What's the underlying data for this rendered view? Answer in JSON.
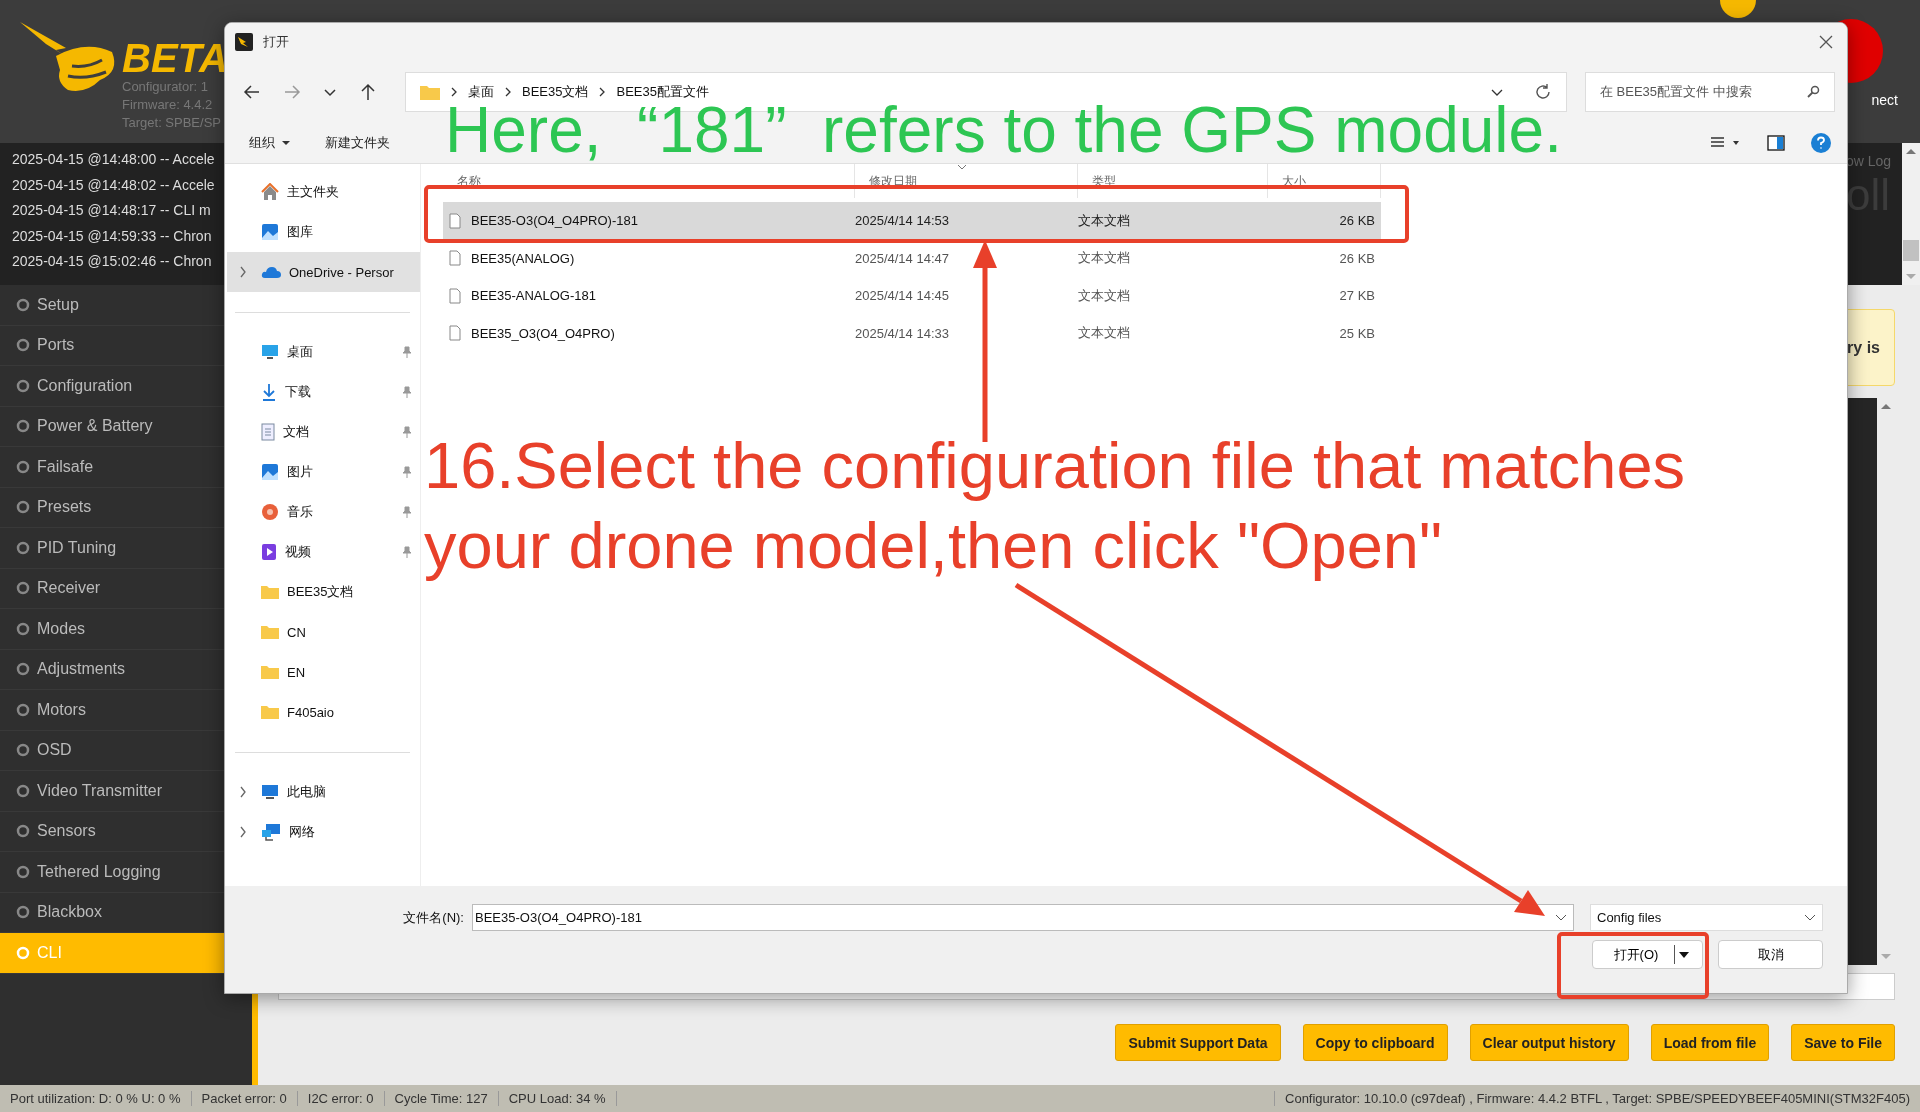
{
  "app": {
    "logo": {
      "text": "BETA"
    },
    "info": [
      "Configurator: 1",
      "Firmware: 4.4.2",
      "Target: SPBE/SP"
    ],
    "connect_label": "nect",
    "log": {
      "lines": [
        "2025-04-15 @14:48:00 -- Accele",
        "2025-04-15 @14:48:02 -- Accele",
        "2025-04-15 @14:48:17 -- CLI m",
        "2025-04-15 @14:59:33 -- Chron",
        "2025-04-15 @15:02:46 -- Chron"
      ],
      "show_log": "ow Log",
      "scroll_label": "oll"
    },
    "sidebar": [
      {
        "label": "Setup",
        "selected": false
      },
      {
        "label": "Ports",
        "selected": false
      },
      {
        "label": "Configuration",
        "selected": false
      },
      {
        "label": "Power & Battery",
        "selected": false
      },
      {
        "label": "Failsafe",
        "selected": false
      },
      {
        "label": "Presets",
        "selected": false
      },
      {
        "label": "PID Tuning",
        "selected": false
      },
      {
        "label": "Receiver",
        "selected": false
      },
      {
        "label": "Modes",
        "selected": false
      },
      {
        "label": "Adjustments",
        "selected": false
      },
      {
        "label": "Motors",
        "selected": false
      },
      {
        "label": "OSD",
        "selected": false
      },
      {
        "label": "Video Transmitter",
        "selected": false
      },
      {
        "label": "Sensors",
        "selected": false
      },
      {
        "label": "Tethered Logging",
        "selected": false
      },
      {
        "label": "Blackbox",
        "selected": false
      },
      {
        "label": "CLI",
        "selected": true
      }
    ],
    "warning": "ry is",
    "buttons": [
      "Submit Support Data",
      "Copy to clipboard",
      "Clear output history",
      "Load from file",
      "Save to File"
    ],
    "status_bar": {
      "left": [
        "Port utilization: D: 0 % U: 0 %",
        "Packet error: 0",
        "I2C error: 0",
        "Cycle Time: 127",
        "CPU Load: 34 %"
      ],
      "right": "Configurator: 10.10.0 (c97deaf) , Firmware: 4.4.2 BTFL , Target: SPBE/SPEEDYBEEF405MINI(STM32F405)"
    }
  },
  "dialog": {
    "title": "打开",
    "path": [
      "桌面",
      "BEE35文档",
      "BEE35配置文件"
    ],
    "search": {
      "placeholder": "在 BEE35配置文件 中搜索"
    },
    "toolbar": [
      "组织",
      "新建文件夹"
    ],
    "nav_groups": [
      [
        {
          "label": "主文件夹",
          "kind": "home",
          "pinned": false,
          "collapsed": false,
          "selected": false
        },
        {
          "label": "图库",
          "kind": "gallery",
          "pinned": false,
          "collapsed": false,
          "selected": false
        },
        {
          "label": "OneDrive - Persor",
          "kind": "cloud",
          "pinned": false,
          "collapsed": true,
          "selected": true
        }
      ],
      [
        {
          "label": "桌面",
          "kind": "desktop",
          "pinned": true,
          "collapsed": false,
          "selected": false
        },
        {
          "label": "下载",
          "kind": "download",
          "pinned": true,
          "collapsed": false,
          "selected": false
        },
        {
          "label": "文档",
          "kind": "document",
          "pinned": true,
          "collapsed": false,
          "selected": false
        },
        {
          "label": "图片",
          "kind": "gallery",
          "pinned": true,
          "collapsed": false,
          "selected": false
        },
        {
          "label": "音乐",
          "kind": "music",
          "pinned": true,
          "collapsed": false,
          "selected": false
        },
        {
          "label": "视频",
          "kind": "video",
          "pinned": true,
          "collapsed": false,
          "selected": false
        },
        {
          "label": "BEE35文档",
          "kind": "folder",
          "pinned": false,
          "collapsed": false,
          "selected": false
        },
        {
          "label": "CN",
          "kind": "folder",
          "pinned": false,
          "collapsed": false,
          "selected": false
        },
        {
          "label": "EN",
          "kind": "folder",
          "pinned": false,
          "collapsed": false,
          "selected": false
        },
        {
          "label": "F405aio",
          "kind": "folder",
          "pinned": false,
          "collapsed": false,
          "selected": false
        }
      ],
      [
        {
          "label": "此电脑",
          "kind": "computer",
          "pinned": false,
          "collapsed": true,
          "selected": false
        },
        {
          "label": "网络",
          "kind": "network",
          "pinned": false,
          "collapsed": true,
          "selected": false
        }
      ]
    ],
    "columns": [
      "名称",
      "修改日期",
      "类型",
      "大小"
    ],
    "files": [
      {
        "name": "BEE35-O3(O4_O4PRO)-181",
        "date": "2025/4/14 14:53",
        "type": "文本文档",
        "size": "26 KB",
        "selected": true
      },
      {
        "name": "BEE35(ANALOG)",
        "date": "2025/4/14 14:47",
        "type": "文本文档",
        "size": "26 KB",
        "selected": false
      },
      {
        "name": "BEE35-ANALOG-181",
        "date": "2025/4/14 14:45",
        "type": "文本文档",
        "size": "27 KB",
        "selected": false
      },
      {
        "name": "BEE35_O3(O4_O4PRO)",
        "date": "2025/4/14 14:33",
        "type": "文本文档",
        "size": "25 KB",
        "selected": false
      }
    ],
    "file_name": {
      "label": "文件名(N):",
      "value": "BEE35-O3(O4_O4PRO)-181"
    },
    "filter": "Config files",
    "buttons": [
      "打开(O)",
      "取消"
    ]
  },
  "annotations": {
    "note": "Here,  “181”  refers to the GPS module.",
    "instruction": "16.Select the configuration file that matches\nyour drone model,then click \"Open\""
  }
}
